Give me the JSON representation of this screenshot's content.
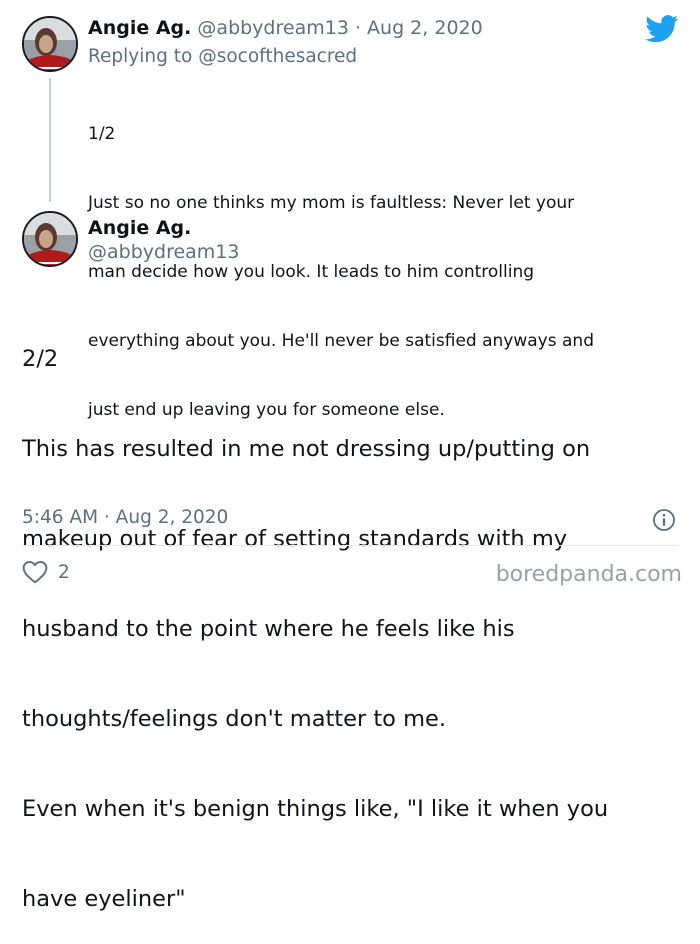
{
  "first_tweet": {
    "author_name": "Angie Ag.",
    "author_handle": "@abbydream13",
    "separator": "·",
    "date": "Aug 2, 2020",
    "replying_to_prefix": "Replying to",
    "replying_to_handle": "@socofthesacred",
    "lines": [
      "1/2",
      "Just so no one thinks my mom is faultless: Never let your",
      "man decide how you look. It leads to him controlling",
      "everything about you. He'll never be satisfied anyways and",
      "just end up leaving you for someone else."
    ]
  },
  "main_tweet": {
    "author_name": "Angie Ag.",
    "author_handle": "@abbydream13",
    "lines": [
      "2/2",
      "This has resulted in me not dressing up/putting on",
      "makeup out of fear of setting standards with my",
      "husband to the point where he feels like his",
      "thoughts/feelings don't matter to me.",
      "Even when it's benign things like, \"I like it when you",
      "have eyeliner\""
    ],
    "timestamp": "5:46 AM · Aug 2, 2020",
    "like_count": "2"
  },
  "watermark": "boredpanda.com",
  "icons": {
    "brand": "twitter-bird-icon",
    "info": "info-icon",
    "like": "heart-icon"
  },
  "colors": {
    "twitter_blue": "#1da1f2",
    "muted": "#5b7083",
    "thread_line": "#c4cfd6"
  }
}
